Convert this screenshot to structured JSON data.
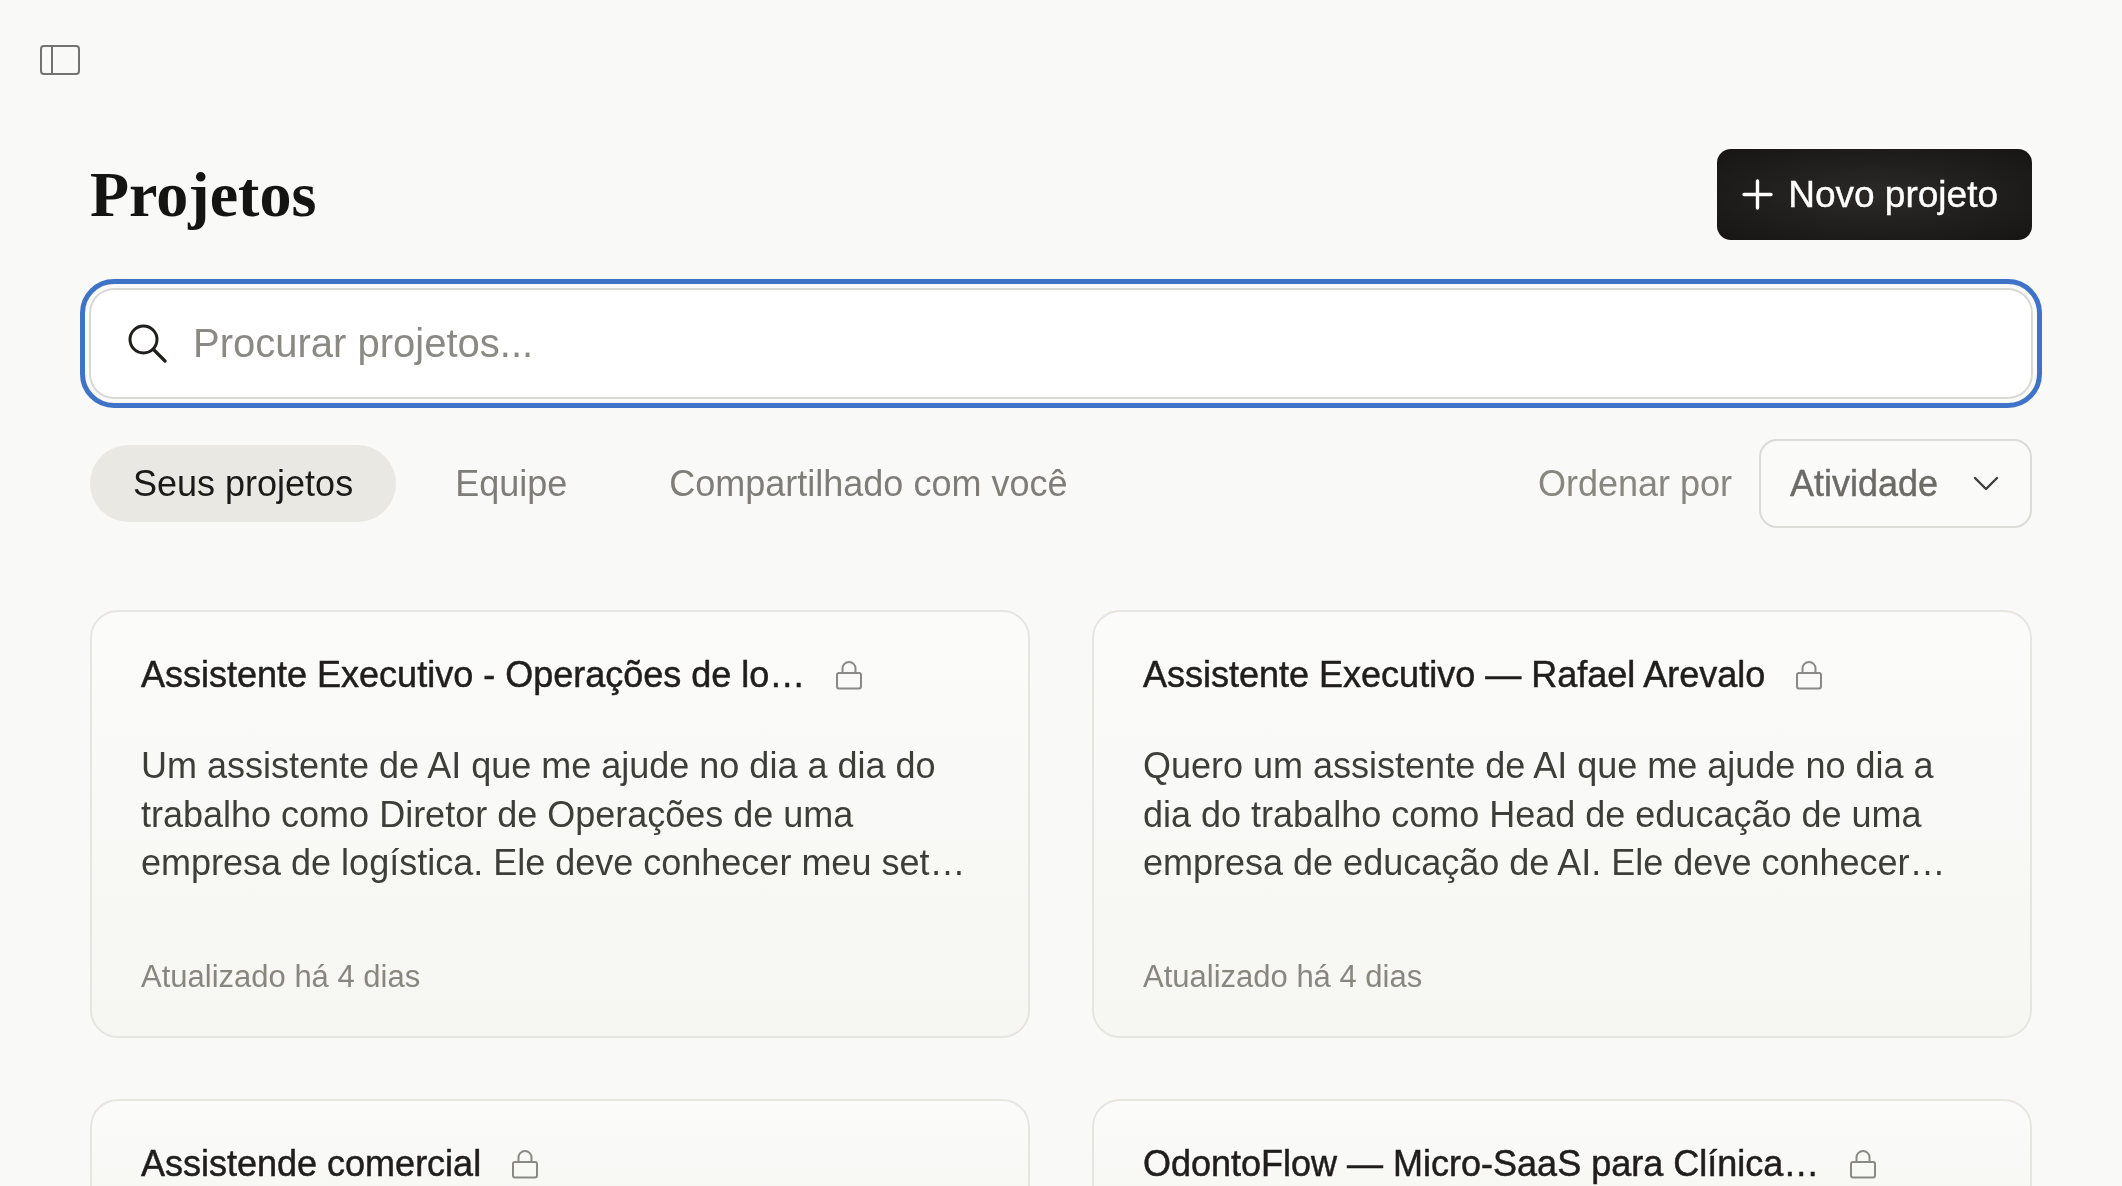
{
  "header": {
    "title": "Projetos",
    "new_project_button": "Novo projeto"
  },
  "search": {
    "placeholder": "Procurar projetos..."
  },
  "tabs": [
    {
      "label": "Seus projetos",
      "selected": true
    },
    {
      "label": "Equipe",
      "selected": false
    },
    {
      "label": "Compartilhado com você",
      "selected": false
    }
  ],
  "sort": {
    "label": "Ordenar por",
    "value": "Atividade"
  },
  "projects": [
    {
      "title": "Assistente Executivo - Operações de lo…",
      "private": true,
      "description": "Um assistente de AI que me ajude no dia a dia do trabalho como Diretor de Operações de uma empresa de logística. Ele deve conhecer meu set…",
      "updated": "Atualizado há 4 dias"
    },
    {
      "title": "Assistente Executivo — Rafael Arevalo",
      "private": true,
      "description": "Quero um assistente de AI que me ajude no dia a dia do trabalho como Head de educação de uma empresa de educação de AI. Ele deve conhecer…",
      "updated": "Atualizado há 4 dias"
    },
    {
      "title": "Assistende comercial",
      "private": true
    },
    {
      "title": "OdontoFlow — Micro-SaaS para Clínica…",
      "private": true
    }
  ]
}
